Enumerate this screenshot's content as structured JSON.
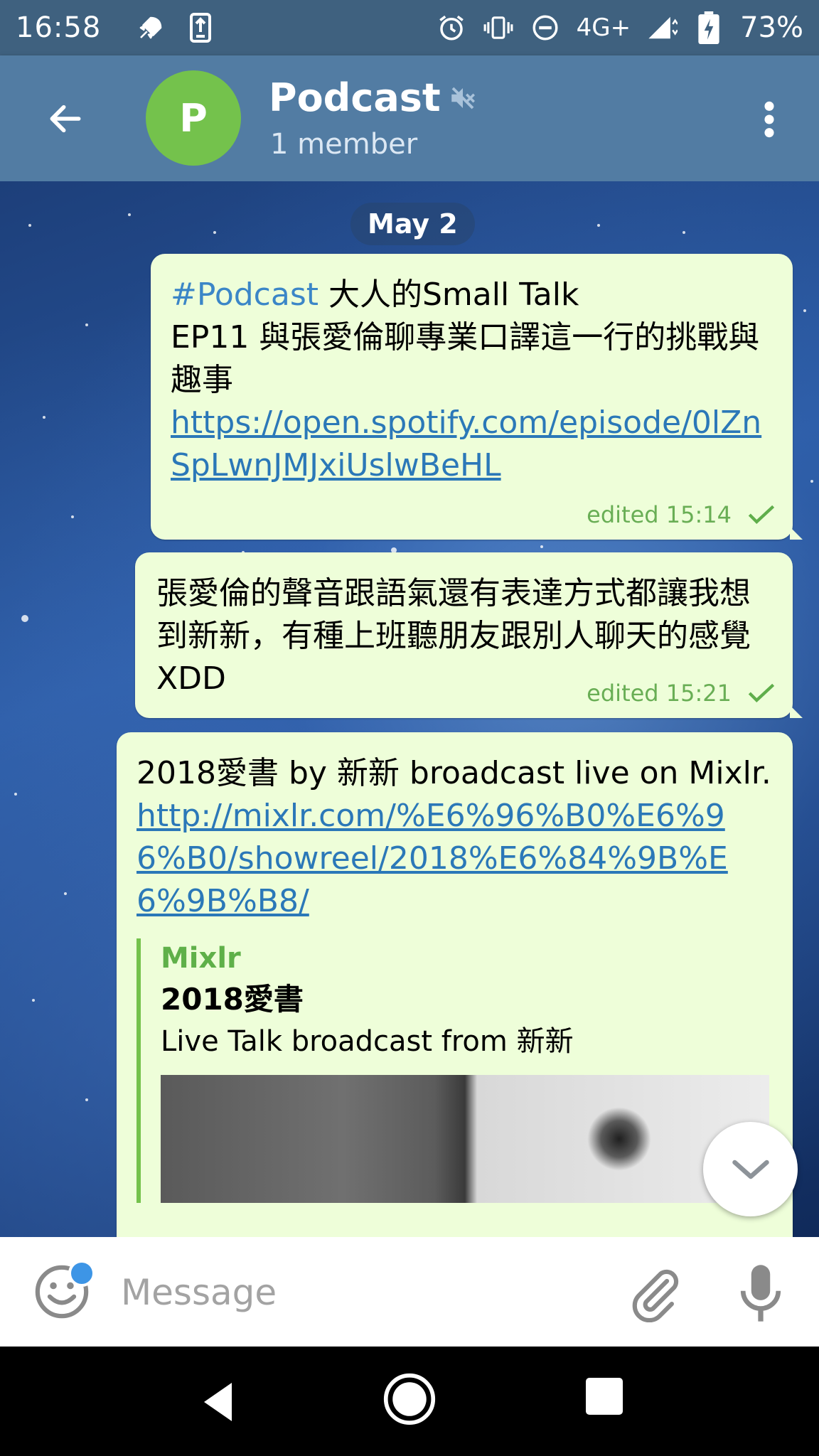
{
  "status_bar": {
    "time": "16:58",
    "network": "4G+",
    "battery": "73%",
    "icons": [
      "rocket-icon",
      "transfer-icon",
      "alarm-icon",
      "vibrate-icon",
      "dnd-icon",
      "signal-icon",
      "battery-charging-icon"
    ]
  },
  "header": {
    "avatar_letter": "P",
    "title": "Podcast",
    "subtitle": "1 member",
    "muted_icon": "muted-speaker-icon",
    "colors": {
      "bar": "#527ca3",
      "avatar": "#74c24c"
    }
  },
  "chat": {
    "date": "May 2",
    "messages": [
      {
        "hashtag": "#Podcast",
        "text_line1": " 大人的Small Talk",
        "text_line2": "EP11 與張愛倫聊專業口譯這一行的挑戰與趣事",
        "link": "https://open.spotify.com/episode/0lZnSpLwnJMJxiUslwBeHL",
        "meta": "edited 15:14"
      },
      {
        "text": "張愛倫的聲音跟語氣還有表達方式都讓我想到新新，有種上班聽朋友跟別人聊天的感覺XDD",
        "meta": "edited 15:21"
      },
      {
        "text": "2018愛書 by 新新 broadcast live on Mixlr.",
        "link": "http://mixlr.com/%E6%96%B0%E6%96%B0/showreel/2018%E6%84%9B%E6%9B%B8/",
        "preview": {
          "site": "Mixlr",
          "title": "2018愛書",
          "description": "Live Talk broadcast from 新新"
        }
      }
    ],
    "colors": {
      "bubble": "#eefed9",
      "link": "#2b78b8",
      "meta": "#69ae55"
    }
  },
  "composer": {
    "placeholder": "Message"
  }
}
